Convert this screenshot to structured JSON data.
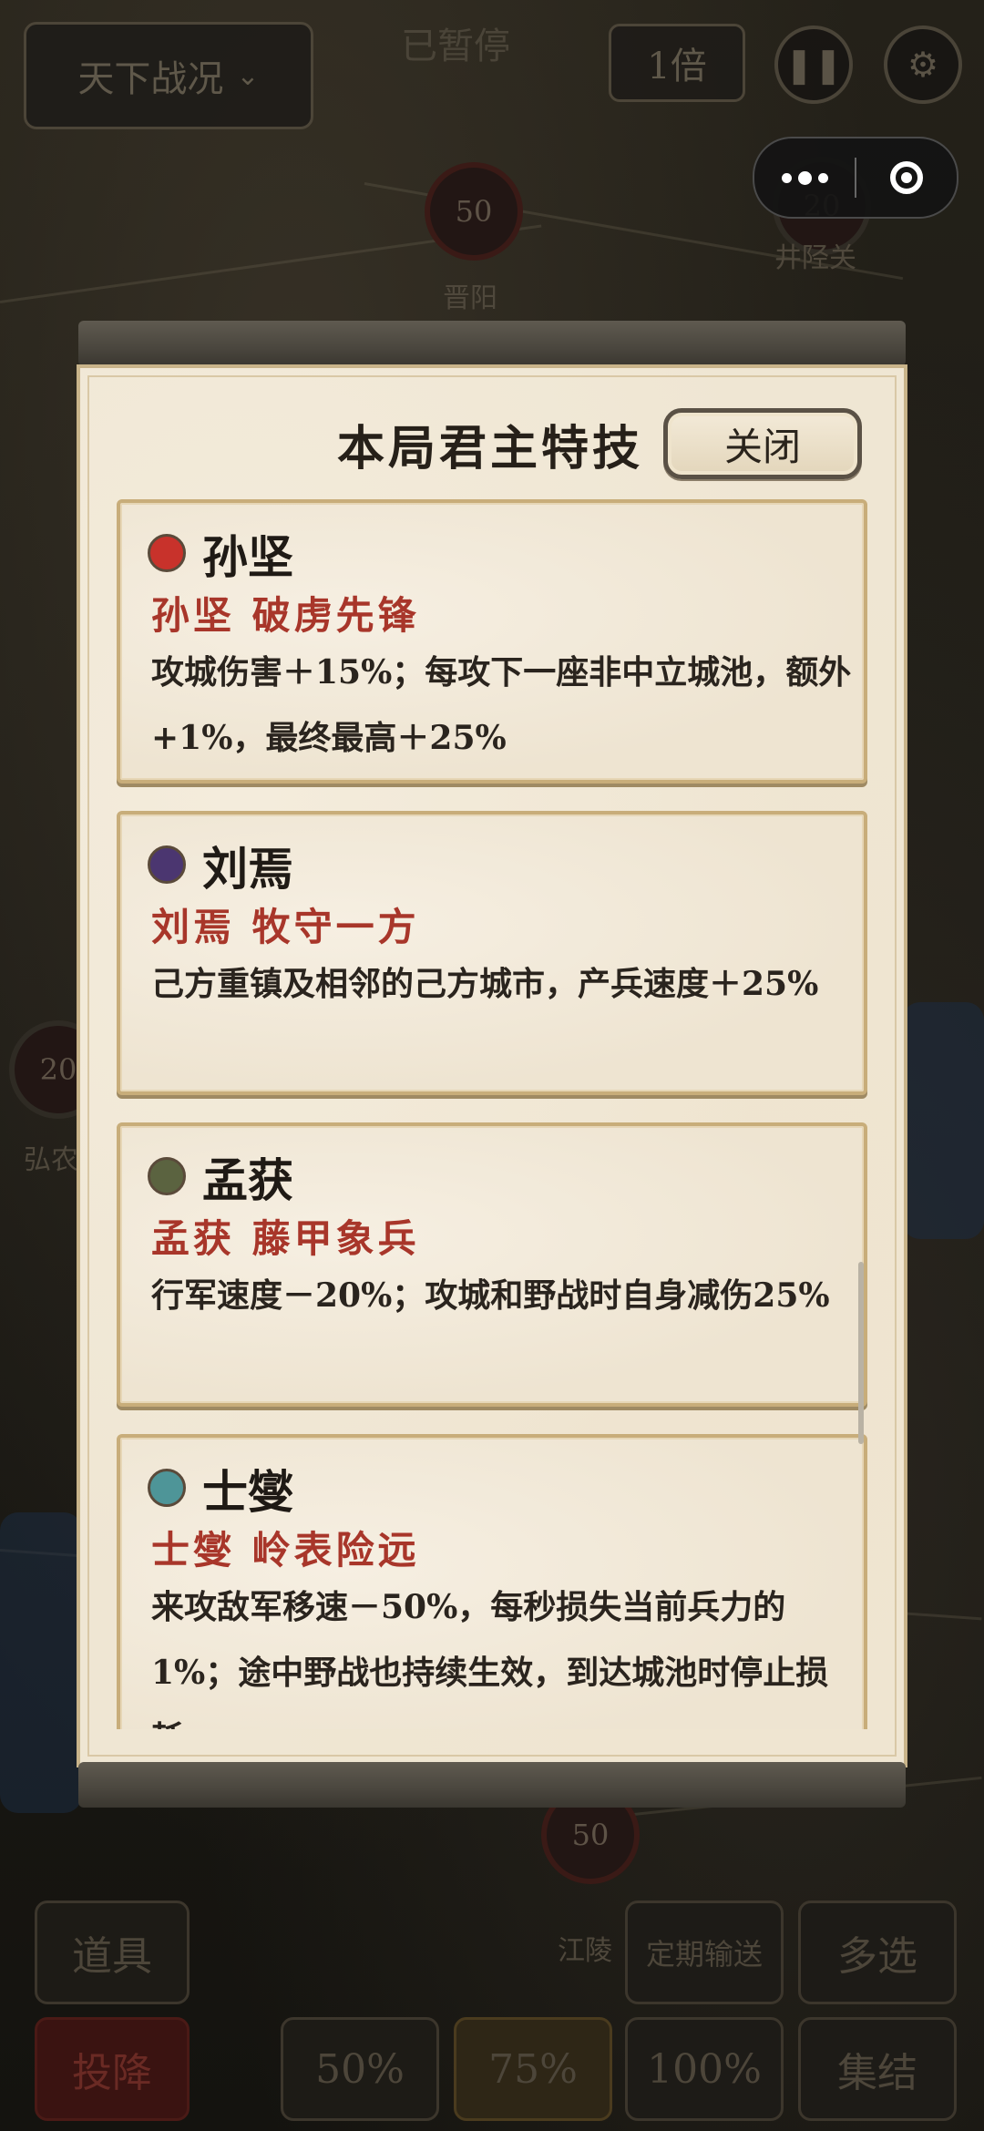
{
  "hud": {
    "region_select": "天下战况",
    "paused": "已暂停",
    "speed": "1倍"
  },
  "map": {
    "cities": [
      {
        "name": "晋阳",
        "troops": "50"
      },
      {
        "name": "井陉关",
        "troops": "20"
      },
      {
        "name": "弘农",
        "troops": "20"
      },
      {
        "name": "江陵",
        "troops": "50"
      }
    ]
  },
  "bottom_bar": {
    "items": "道具",
    "transport": "定期输送",
    "multi": "多选",
    "surrender": "投降",
    "pct50": "50%",
    "pct75": "75%",
    "pct100": "100%",
    "gather": "集结"
  },
  "dialog": {
    "title": "本局君主特技",
    "close": "关闭",
    "lords": [
      {
        "name": "孙坚",
        "color": "#c8322b",
        "skill": "孙坚  破虏先锋",
        "desc": "攻城伤害＋15%；每攻下一座非中立城池，额外+1%，最终最高＋25%"
      },
      {
        "name": "刘焉",
        "color": "#4b3670",
        "skill": "刘焉  牧守一方",
        "desc": "己方重镇及相邻的己方城市，产兵速度＋25%"
      },
      {
        "name": "孟获",
        "color": "#5b6340",
        "skill": "孟获  藤甲象兵",
        "desc": "行军速度－20%；攻城和野战时自身减伤25%"
      },
      {
        "name": "士燮",
        "color": "#4e9598",
        "skill": "士燮  岭表险远",
        "desc": "来攻敌军移速－50%，每秒损失当前兵力的1%；途中野战也持续生效，到达城池时停止损耗"
      }
    ]
  }
}
